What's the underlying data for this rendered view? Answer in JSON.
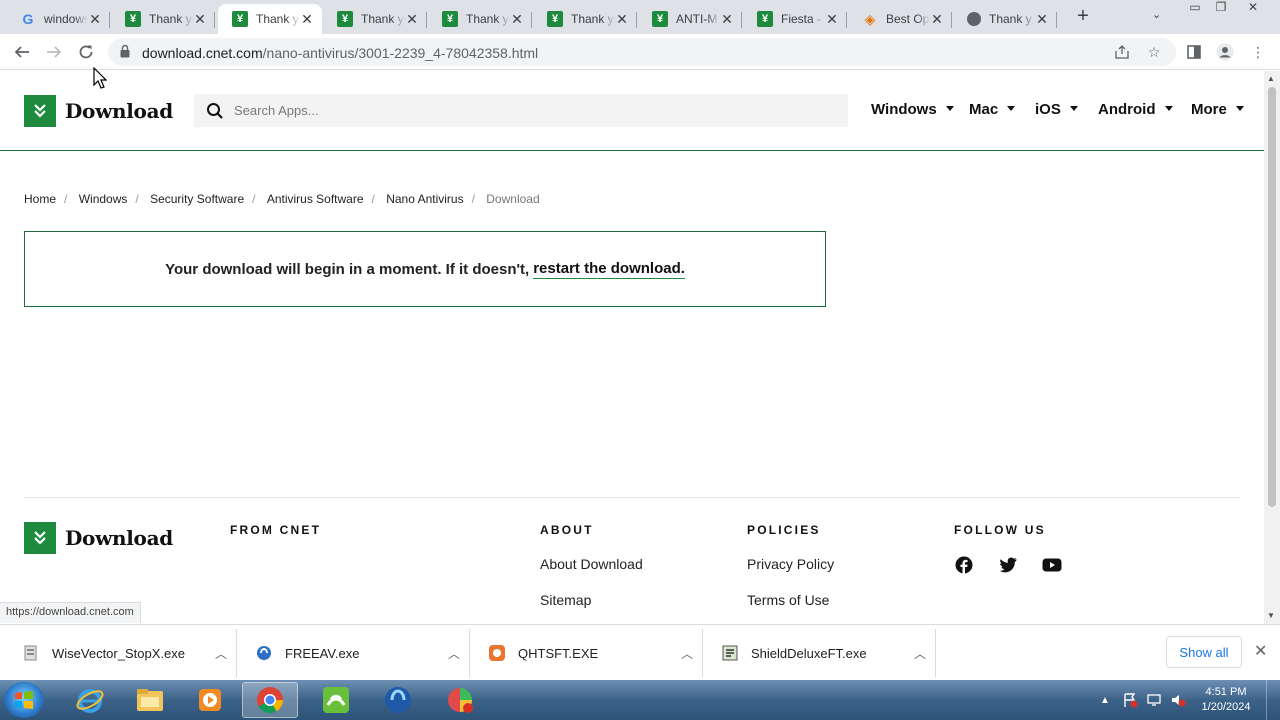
{
  "browser": {
    "tabs": [
      {
        "title": "windows",
        "favicon": "google-icon"
      },
      {
        "title": "Thank you",
        "favicon": "cnet-icon"
      },
      {
        "title": "Thank you",
        "favicon": "cnet-icon",
        "active": true
      },
      {
        "title": "Thank you",
        "favicon": "cnet-icon"
      },
      {
        "title": "Thank you",
        "favicon": "cnet-icon"
      },
      {
        "title": "Thank you",
        "favicon": "cnet-icon"
      },
      {
        "title": "ANTI-M",
        "favicon": "cnet-icon"
      },
      {
        "title": "Fiesta -",
        "favicon": "cnet-icon"
      },
      {
        "title": "Best Op",
        "favicon": "orange-diamond-icon"
      },
      {
        "title": "Thank y",
        "favicon": "globe-icon"
      }
    ],
    "new_tab": "+",
    "url_host": "download.cnet.com",
    "url_path": "/nano-antivirus/3001-2239_4-78042358.html"
  },
  "site": {
    "logo_text": "Download",
    "search_placeholder": "Search Apps...",
    "nav": [
      "Windows",
      "Mac",
      "iOS",
      "Android",
      "More"
    ],
    "breadcrumb": [
      "Home",
      "Windows",
      "Security Software",
      "Antivirus Software",
      "Nano Antivirus",
      "Download"
    ],
    "notice_text": "Your download will begin in a moment. If it doesn't,",
    "notice_link": "restart the download."
  },
  "footer": {
    "logo_text": "Download",
    "from_cnet": "FROM CNET",
    "about": {
      "heading": "ABOUT",
      "links": [
        "About Download",
        "Sitemap"
      ]
    },
    "policies": {
      "heading": "POLICIES",
      "links": [
        "Privacy Policy",
        "Terms of Use"
      ]
    },
    "follow": {
      "heading": "FOLLOW US",
      "icons": [
        "facebook-icon",
        "twitter-icon",
        "youtube-icon"
      ]
    }
  },
  "status_bar_url": "https://download.cnet.com",
  "downloads": {
    "items": [
      {
        "name": "WiseVector_StopX.exe",
        "icon": "installer-icon"
      },
      {
        "name": "FREEAV.exe",
        "icon": "blue-shield-icon"
      },
      {
        "name": "QHTSFT.EXE",
        "icon": "orange-app-icon"
      },
      {
        "name": "ShieldDeluxeFT.exe",
        "icon": "shield-app-icon"
      }
    ],
    "show_all": "Show all"
  },
  "taskbar": {
    "apps": [
      "internet-explorer-icon",
      "file-explorer-icon",
      "media-player-icon",
      "chrome-icon",
      "green-app-icon",
      "blue-app-icon",
      "colorful-app-icon"
    ],
    "clock_time": "4:51 PM",
    "clock_date": "1/20/2024"
  },
  "colors": {
    "brand_green": "#1d8a3d",
    "rule_green": "#1d6b3a",
    "tab_strip": "#dee1e6",
    "link_blue": "#1a73e8"
  }
}
